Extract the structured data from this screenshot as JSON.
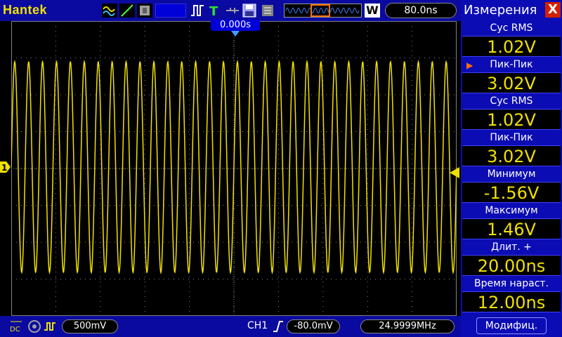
{
  "header": {
    "brand": "Hantek",
    "mode_button": "W",
    "timebase": "80.0ns"
  },
  "scope": {
    "trigger_position": "0.000s",
    "channel_marker": "1",
    "trace_color": "#f0e000",
    "grid_color": "#808080"
  },
  "measurements": {
    "title": "Измерения",
    "close_label": "X",
    "items": [
      {
        "label": "Cyc  RMS",
        "value": "1.02V"
      },
      {
        "label": "Пик-Пик",
        "value": "3.02V",
        "selected": true
      },
      {
        "label": "Cyc  RMS",
        "value": "1.02V"
      },
      {
        "label": "Пик-Пик",
        "value": "3.02V"
      },
      {
        "label": "Минимум",
        "value": "-1.56V"
      },
      {
        "label": "Максимум",
        "value": "1.46V"
      },
      {
        "label": "Длит.  +",
        "value": "20.00ns"
      },
      {
        "label": "Время  нараст.",
        "value": "12.00ns"
      }
    ],
    "modify_label": "Модифиц."
  },
  "footer": {
    "coupling": "DC",
    "volts_div": "500mV",
    "trigger_channel": "CH1",
    "trigger_level": "-80.0mV",
    "frequency": "24.9999MHz"
  }
}
